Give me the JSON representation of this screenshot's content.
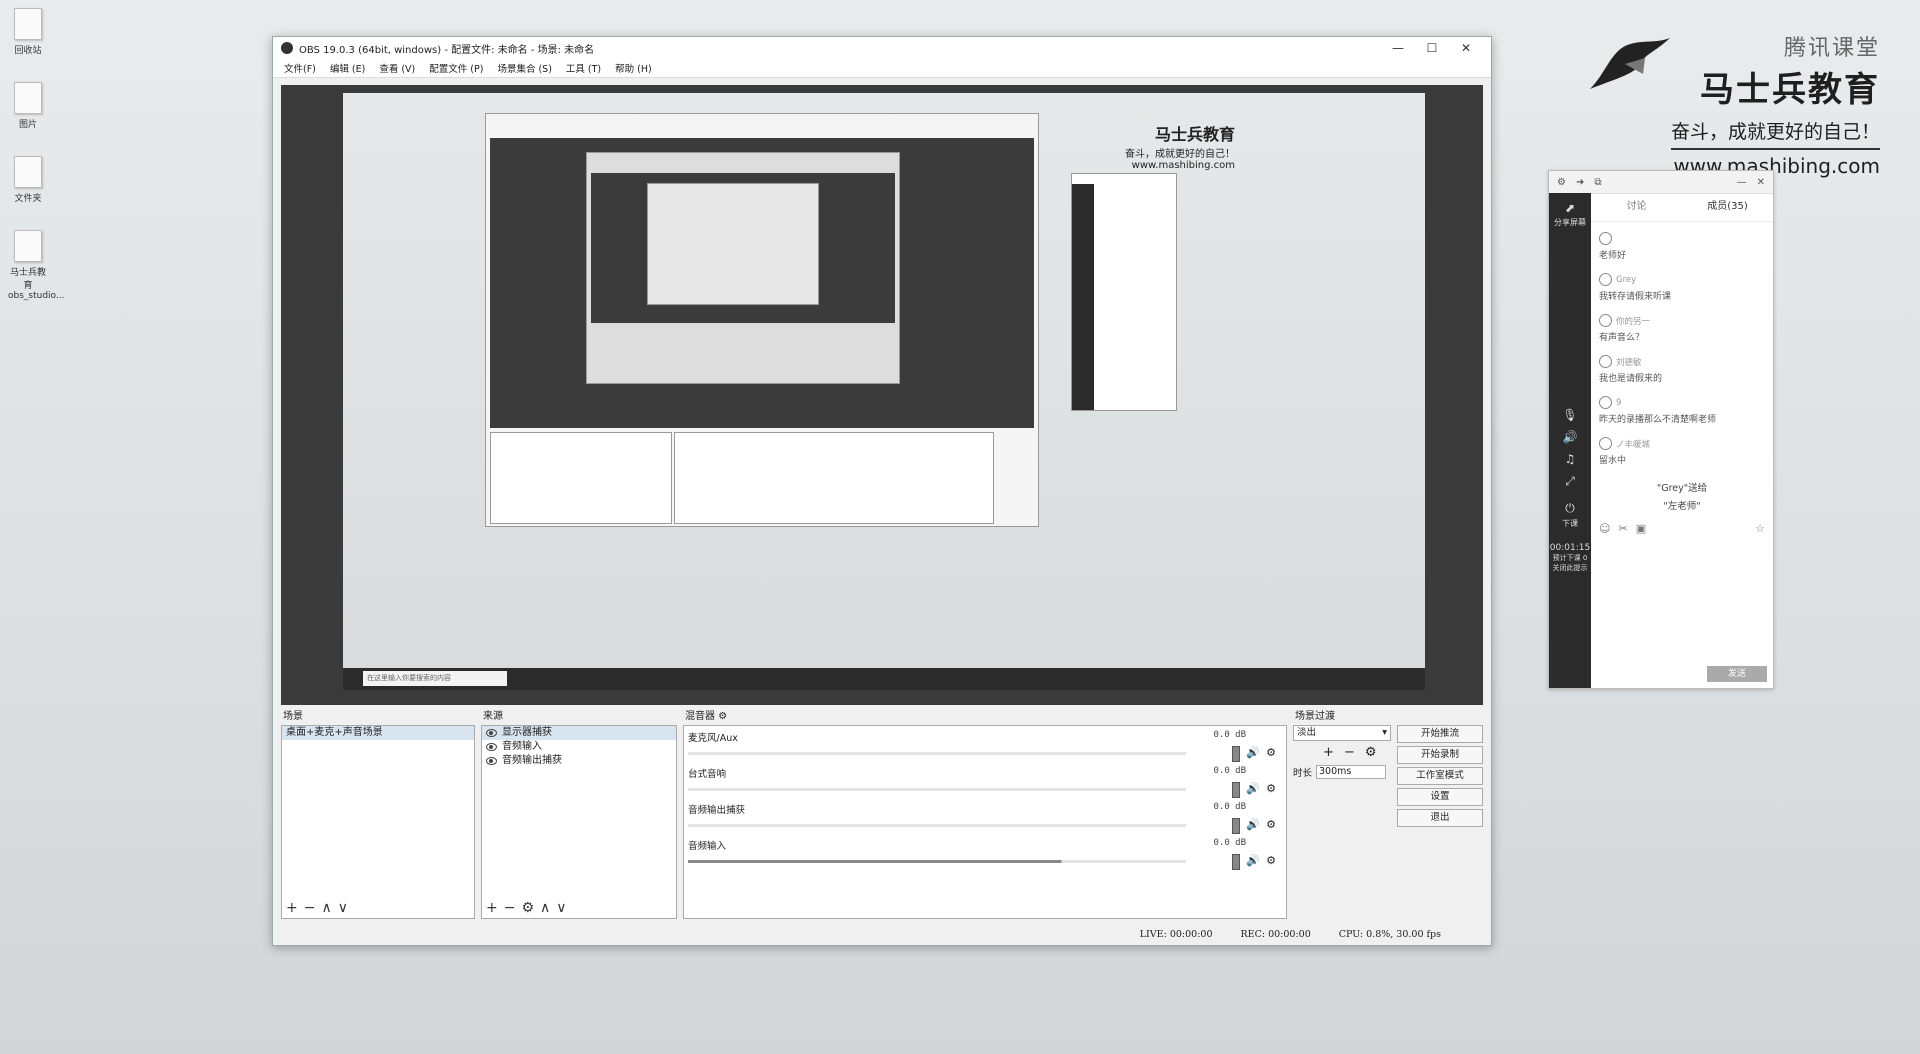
{
  "desktop": {
    "icons": [
      {
        "label": "回收站"
      },
      {
        "label": "图片"
      },
      {
        "label": "文件夹"
      },
      {
        "label": "马士兵教育 obs_studio..."
      }
    ]
  },
  "watermark": {
    "brand_top": "腾讯课堂",
    "brand_main": "马士兵教育",
    "slogan": "奋斗，成就更好的自己！",
    "url": "www.mashibing.com"
  },
  "obs": {
    "title": "OBS 19.0.3 (64bit, windows) - 配置文件: 未命名 - 场景: 未命名",
    "window_controls": {
      "minimize": "—",
      "maximize": "☐",
      "close": "✕"
    },
    "menu": [
      "文件(F)",
      "编辑 (E)",
      "查看 (V)",
      "配置文件 (P)",
      "场景集合 (S)",
      "工具 (T)",
      "帮助 (H)"
    ],
    "preview": {
      "nested_search_placeholder": "在这里输入你要搜索的内容",
      "nested_watermark_main": "马士兵教育",
      "nested_watermark_slogan": "奋斗，成就更好的自己！",
      "nested_watermark_url": "www.mashibing.com"
    },
    "scenes": {
      "title": "场景",
      "items": [
        {
          "label": "桌面+麦克+声音场景",
          "selected": true
        }
      ],
      "tools": [
        "+",
        "−",
        "∧",
        "∨"
      ]
    },
    "sources": {
      "title": "来源",
      "items": [
        {
          "label": "显示器捕获",
          "selected": true
        },
        {
          "label": "音频输入"
        },
        {
          "label": "音频输出捕获"
        }
      ],
      "tools": [
        "+",
        "−",
        "⚙",
        "∧",
        "∨"
      ]
    },
    "mixer": {
      "title": "混音器",
      "channels": [
        {
          "name": "麦克风/Aux",
          "db": "0.0 dB"
        },
        {
          "name": "台式音响",
          "db": "0.0 dB"
        },
        {
          "name": "音频输出捕获",
          "db": "0.0 dB"
        },
        {
          "name": "音频输入",
          "db": "0.0 dB"
        }
      ]
    },
    "transitions": {
      "title": "场景过渡",
      "selected": "淡出",
      "duration_label": "时长",
      "duration_value": "300ms",
      "tools": [
        "+",
        "−",
        "⚙"
      ]
    },
    "controls": {
      "start_stream": "开始推流",
      "start_record": "开始录制",
      "studio_mode": "工作室模式",
      "settings": "设置",
      "exit": "退出"
    },
    "status": {
      "live": "LIVE: 00:00:00",
      "rec": "REC: 00:00:00",
      "cpu": "CPU: 0.8%, 30.00 fps"
    }
  },
  "chat": {
    "tabs": {
      "discuss": "讨论",
      "members": "成员(35)"
    },
    "sidebar": {
      "share": "分享屏幕",
      "end_class": "下课",
      "timer": "00:01:15",
      "timer_note": "预计下课 0 关闭此提示"
    },
    "messages": [
      {
        "user": "",
        "text": "老师好"
      },
      {
        "user": "Grey",
        "text": "我转存请假来听课"
      },
      {
        "user": "你的另一",
        "text": "有声音么？"
      },
      {
        "user": "刘德敏",
        "text": "我也是请假来的"
      },
      {
        "user": "9",
        "text": "昨天的录播那么不清楚啊老师"
      },
      {
        "user": "ノ丰暖城",
        "text": "留水中"
      }
    ],
    "gift": {
      "line1": "\"Grey\"送给",
      "line2": "\"左老师\""
    },
    "send": "发送"
  }
}
